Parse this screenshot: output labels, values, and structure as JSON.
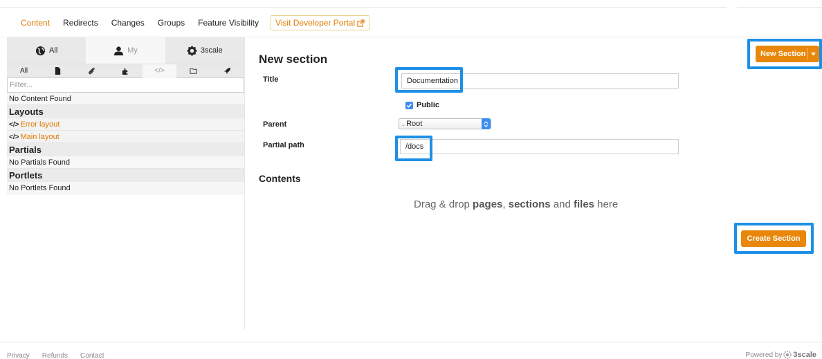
{
  "topnav": {
    "items": [
      "Content",
      "Redirects",
      "Changes",
      "Groups",
      "Feature Visibility"
    ],
    "dev_portal": "Visit Developer Portal"
  },
  "sidebar": {
    "scope_tabs": [
      "All",
      "My",
      "3scale"
    ],
    "type_tabs_all": "All",
    "filter_placeholder": "Filter...",
    "no_content": "No Content Found",
    "layouts_title": "Layouts",
    "layouts": [
      "Error layout",
      "Main layout"
    ],
    "code_glyph": "</>",
    "partials_title": "Partials",
    "no_partials": "No Partials Found",
    "portlets_title": "Portlets",
    "no_portlets": "No Portlets Found"
  },
  "main": {
    "title": "New section",
    "title_label": "Title",
    "title_value": "Documentation",
    "public_label": "Public",
    "parent_label": "Parent",
    "parent_value": ". Root",
    "partial_path_label": "Partial path",
    "partial_path_value": "/docs",
    "contents_title": "Contents",
    "drop_prefix": "Drag & drop",
    "drop_pages": "pages",
    "drop_sections": "sections",
    "drop_and": "and",
    "drop_files": "files",
    "drop_suffix": "here"
  },
  "buttons": {
    "new_section": "New Section",
    "create_section": "Create Section"
  },
  "footer": {
    "links": [
      "Privacy",
      "Refunds",
      "Contact"
    ],
    "powered_by": "Powered by",
    "brand": "3scale"
  },
  "colors": {
    "accent": "#e8870a",
    "highlight": "#1e8fe6",
    "link": "#e07b00"
  }
}
